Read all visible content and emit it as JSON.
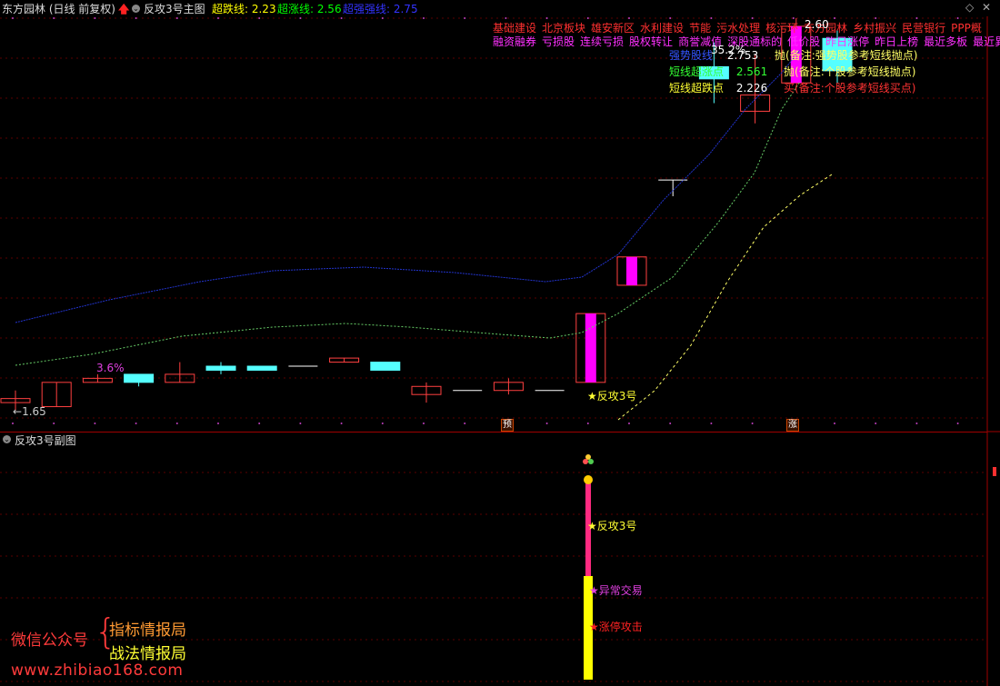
{
  "header": {
    "stock": "东方园林 (日线 前复权)",
    "indicator_title": "反攻3号主图",
    "lines": [
      {
        "label": "超跌线: 2.23",
        "color": "#ffff00"
      },
      {
        "label": "超涨线: 2.56",
        "color": "#00ff00"
      },
      {
        "label": "超强强线: 2.75",
        "color": "#3333ff"
      }
    ],
    "icons": [
      "chevron-down-icon",
      "up-arrow-icon",
      "diamond-icon",
      "close-icon"
    ]
  },
  "tags": {
    "row1": [
      "基础建设",
      "北京板块",
      "雄安新区",
      "水利建设",
      "节能",
      "污水处理",
      "核污环",
      "东方园林",
      "乡村振兴",
      "民营银行",
      "PPP概"
    ],
    "row1_color": "#ff3030",
    "row2": [
      "融资融券",
      "亏损股",
      "连续亏损",
      "股权转让",
      "商誉减值",
      "深股通标的",
      "低价股",
      "昨日涨停",
      "昨日上榜",
      "最近多板",
      "最近異"
    ],
    "row2_color": "#ff30ff"
  },
  "legend": [
    {
      "label": "强势股线",
      "value": "2.753",
      "note": "抛(备注:强势股参考短线抛点)",
      "color": "#3355ff",
      "note_color": "#ffff66"
    },
    {
      "label": "短线超涨点",
      "value": "2.561",
      "note": "抛(备注:个股参考短线抛点)",
      "color": "#33ff33",
      "note_color": "#ffff66"
    },
    {
      "label": "短线超跌点",
      "value": "2.226",
      "note": "买(备注:个股参考短线买点)",
      "color": "#ffff33",
      "note_color": "#ff3333"
    }
  ],
  "annotations": {
    "pct_low": "3.6%",
    "pct_high": "35.2%",
    "price_high": "2.60",
    "price_low": "1.65",
    "signal_main": "★反攻3号",
    "pin_yu": "预",
    "pin_zhang": "涨"
  },
  "sub_panel": {
    "title": "反攻3号副图",
    "signal1": "★反攻3号",
    "signal2": "★异常交易",
    "signal3": "★涨停攻击"
  },
  "watermark": {
    "wechat": "微信公众号",
    "line1": "指标情报局",
    "line2": "战法情报局",
    "url": "www.zhibiao168.com"
  },
  "chart_data": {
    "type": "candlestick",
    "title": "东方园林 (日线 前复权)",
    "candles": [
      {
        "o": 1.67,
        "h": 1.7,
        "l": 1.65,
        "c": 1.68
      },
      {
        "o": 1.66,
        "h": 1.72,
        "l": 1.66,
        "c": 1.72
      },
      {
        "o": 1.72,
        "h": 1.74,
        "l": 1.72,
        "c": 1.73
      },
      {
        "o": 1.74,
        "h": 1.74,
        "l": 1.71,
        "c": 1.72
      },
      {
        "o": 1.72,
        "h": 1.77,
        "l": 1.72,
        "c": 1.74
      },
      {
        "o": 1.76,
        "h": 1.77,
        "l": 1.74,
        "c": 1.75
      },
      {
        "o": 1.76,
        "h": 1.76,
        "l": 1.75,
        "c": 1.75
      },
      {
        "o": 1.76,
        "h": 1.76,
        "l": 1.76,
        "c": 1.76
      },
      {
        "o": 1.77,
        "h": 1.78,
        "l": 1.77,
        "c": 1.78
      },
      {
        "o": 1.77,
        "h": 1.77,
        "l": 1.75,
        "c": 1.75
      },
      {
        "o": 1.69,
        "h": 1.72,
        "l": 1.67,
        "c": 1.71
      },
      {
        "o": 1.7,
        "h": 1.7,
        "l": 1.7,
        "c": 1.7
      },
      {
        "o": 1.7,
        "h": 1.73,
        "l": 1.69,
        "c": 1.72
      },
      {
        "o": 1.7,
        "h": 1.7,
        "l": 1.7,
        "c": 1.7
      },
      {
        "o": 1.72,
        "h": 1.89,
        "l": 1.72,
        "c": 1.89
      },
      {
        "o": 1.96,
        "h": 2.03,
        "l": 1.96,
        "c": 2.03
      },
      {
        "o": 2.22,
        "h": 2.22,
        "l": 2.18,
        "c": 2.22
      },
      {
        "o": 2.5,
        "h": 2.56,
        "l": 2.41,
        "c": 2.47
      },
      {
        "o": 2.39,
        "h": 2.53,
        "l": 2.36,
        "c": 2.43
      },
      {
        "o": 2.46,
        "h": 2.62,
        "l": 2.46,
        "c": 2.6
      },
      {
        "o": 2.57,
        "h": 2.59,
        "l": 2.46,
        "c": 2.49
      }
    ]
  }
}
